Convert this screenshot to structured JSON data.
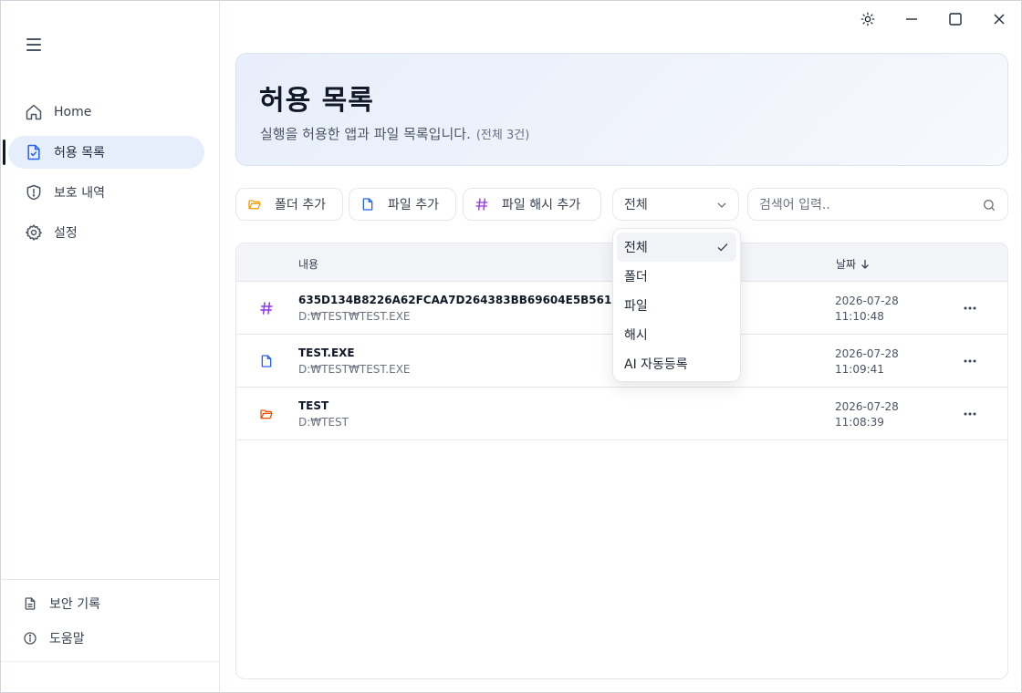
{
  "sidebar": {
    "items": [
      {
        "label": "Home",
        "icon": "home-icon"
      },
      {
        "label": "허용 목록",
        "icon": "file-check-icon"
      },
      {
        "label": "보호 내역",
        "icon": "shield-alert-icon"
      },
      {
        "label": "설정",
        "icon": "gear-icon"
      }
    ],
    "bottom": [
      {
        "label": "보안 기록",
        "icon": "document-icon"
      },
      {
        "label": "도움말",
        "icon": "info-icon"
      }
    ]
  },
  "header": {
    "title": "허용 목록",
    "subtitle": "실행을 허용한 앱과 파일 목록입니다.",
    "count": "(전체 3건)"
  },
  "toolbar": {
    "add_folder": "폴더 추가",
    "add_file": "파일 추가",
    "add_hash": "파일 해시 추가",
    "filter_value": "전체",
    "search_placeholder": "검색어 입력.."
  },
  "table": {
    "col_content": "내용",
    "col_date": "날짜",
    "rows": [
      {
        "type": "hash",
        "name": "635D134B8226A62FCAA7D264383BB69604E5B561659CDFAC",
        "path": "D:₩TEST₩TEST.EXE",
        "date": "2026-07-28",
        "time": "11:10:48"
      },
      {
        "type": "file",
        "name": "TEST.EXE",
        "path": "D:₩TEST₩TEST.EXE",
        "date": "2026-07-28",
        "time": "11:09:41"
      },
      {
        "type": "folder",
        "name": "TEST",
        "path": "D:₩TEST",
        "date": "2026-07-28",
        "time": "11:08:39"
      }
    ]
  },
  "dropdown": {
    "options": [
      "전체",
      "폴더",
      "파일",
      "해시",
      "AI 자동등록"
    ],
    "selected": "전체"
  },
  "colors": {
    "accent": "#2563eb",
    "hash": "#9333ea",
    "folder_toolbar": "#f59e0b",
    "folder_row": "#ea580c",
    "file": "#2563eb"
  }
}
